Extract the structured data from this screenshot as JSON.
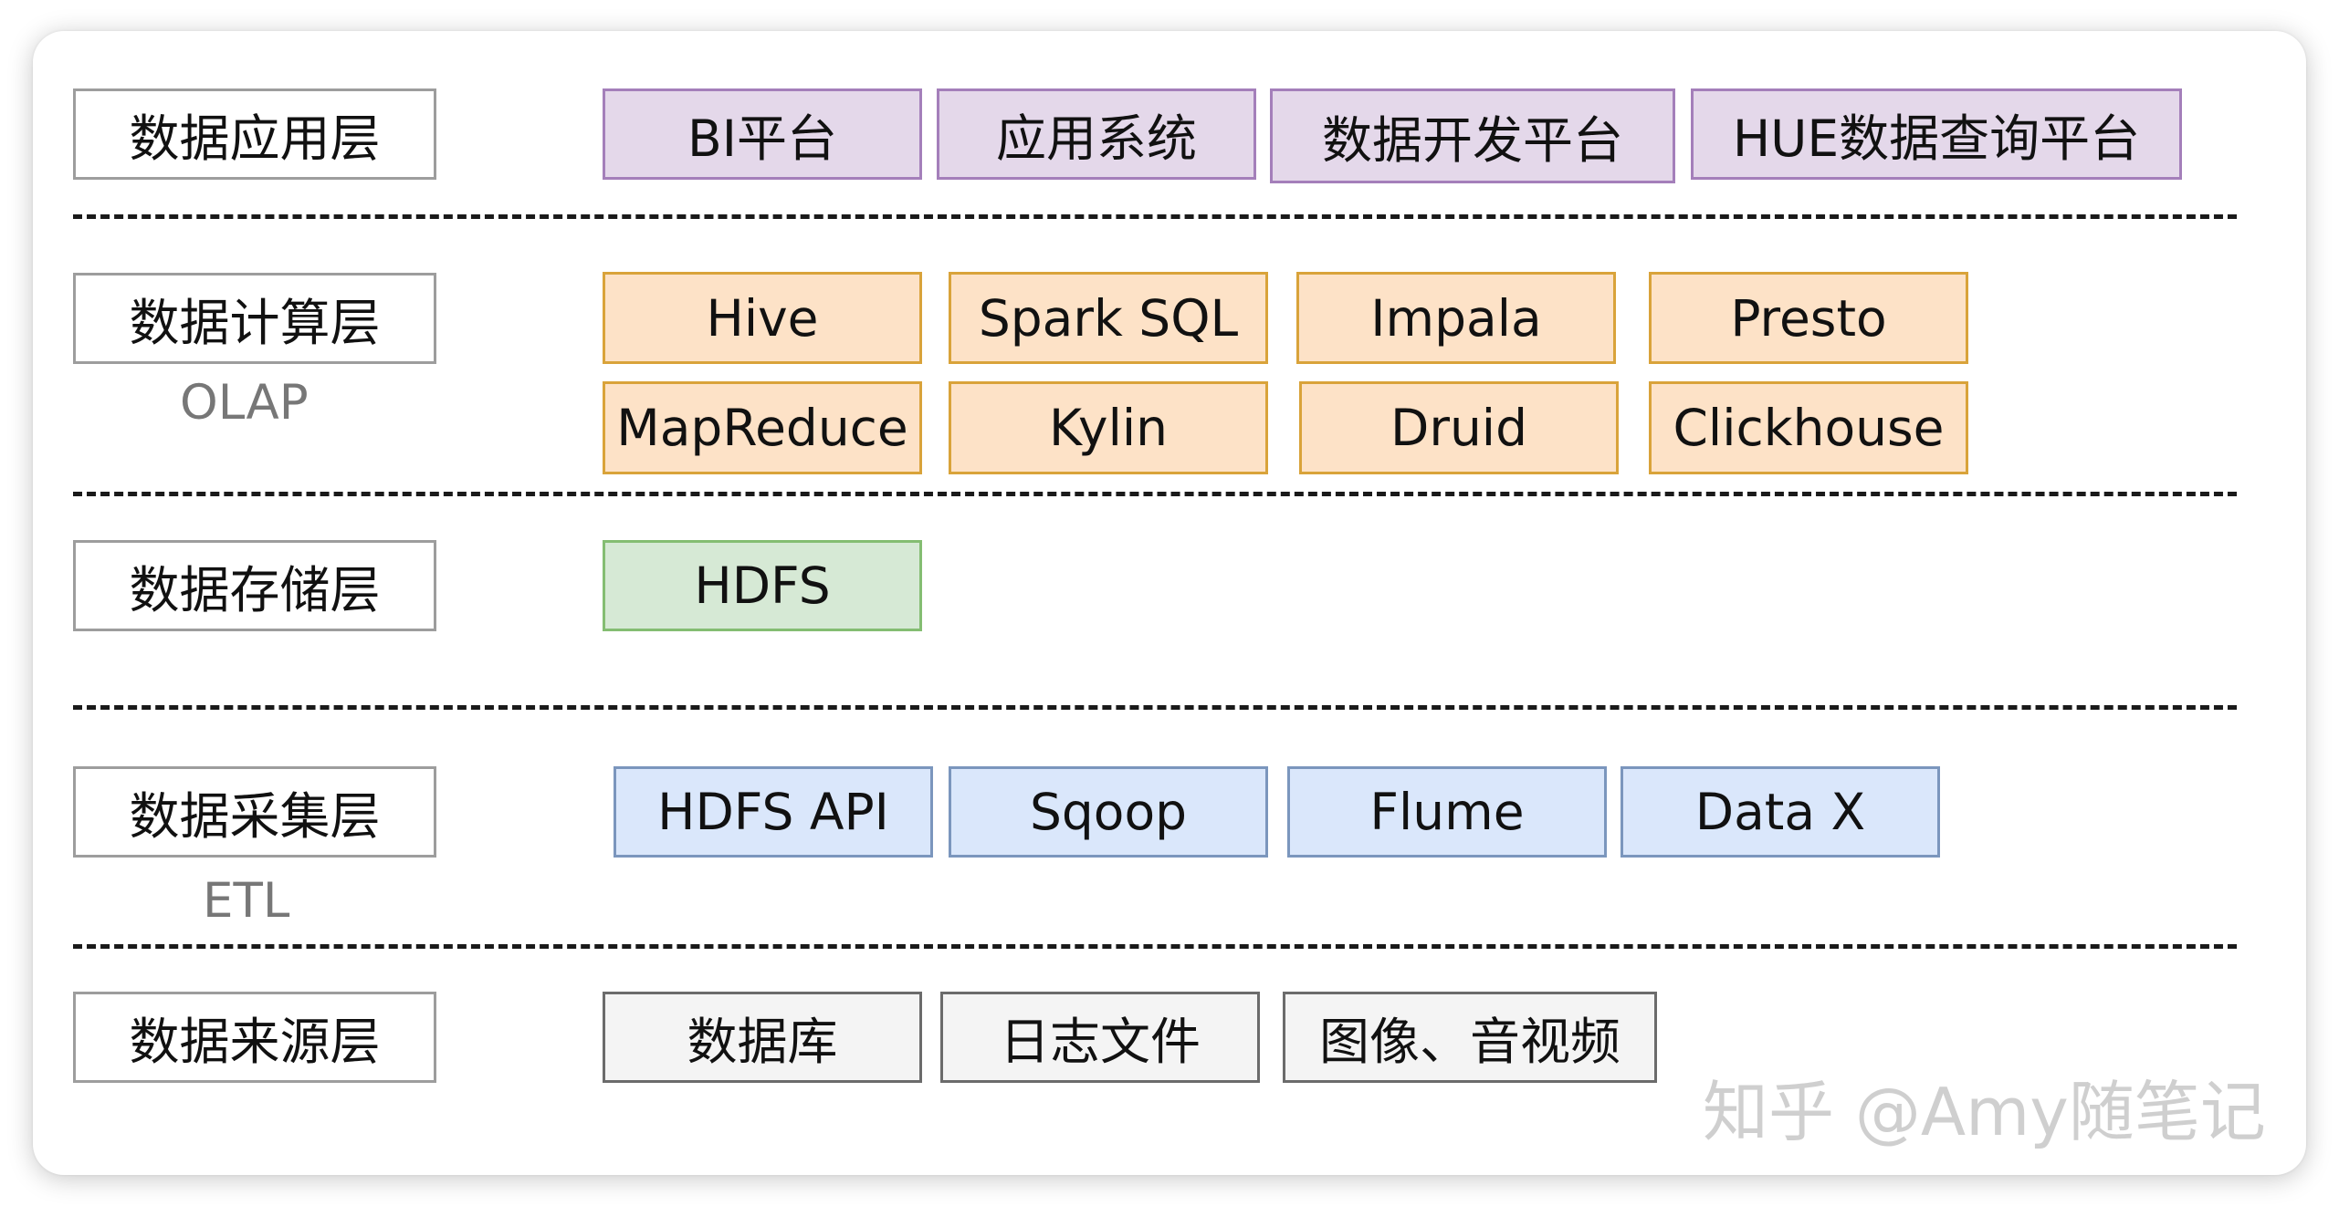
{
  "layers": [
    {
      "label": "数据应用层",
      "sub": "",
      "items": [
        "BI平台",
        "应用系统",
        "数据开发平台",
        "HUE数据查询平台"
      ]
    },
    {
      "label": "数据计算层",
      "sub": "OLAP",
      "items": [
        "Hive",
        "Spark SQL",
        "Impala",
        "Presto",
        "MapReduce",
        "Kylin",
        "Druid",
        "Clickhouse"
      ]
    },
    {
      "label": "数据存储层",
      "sub": "",
      "items": [
        "HDFS"
      ]
    },
    {
      "label": "数据采集层",
      "sub": "ETL",
      "items": [
        "HDFS API",
        "Sqoop",
        "Flume",
        "Data X"
      ]
    },
    {
      "label": "数据来源层",
      "sub": "",
      "items": [
        "数据库",
        "日志文件",
        "图像、音视频"
      ]
    }
  ],
  "watermark": "知乎 @Amy随笔记",
  "colors": {
    "application": "#e4d8ea",
    "compute": "#fde2c7",
    "storage": "#d6e9d5",
    "ingestion": "#dae7fb",
    "source": "#f4f4f4"
  }
}
